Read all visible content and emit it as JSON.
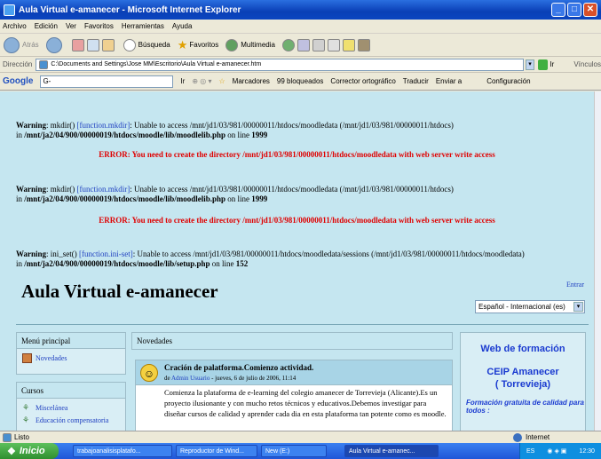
{
  "window": {
    "title": "Aula Virtual e-amanecer - Microsoft Internet Explorer",
    "controls": [
      "_",
      "□",
      "✕"
    ]
  },
  "menu": [
    "Archivo",
    "Edición",
    "Ver",
    "Favoritos",
    "Herramientas",
    "Ayuda"
  ],
  "toolbar": {
    "back": "Atrás",
    "search": "Búsqueda",
    "favorites": "Favoritos",
    "multimedia": "Multimedia"
  },
  "address": {
    "label": "Dirección",
    "value": "C:\\Documents and Settings\\Jose MM\\Escritorio\\Aula Virtual e-amanecer.htm",
    "go": "Ir",
    "links": "Vínculos"
  },
  "google": {
    "logo": "Google",
    "input": "G-",
    "go": "Ir",
    "bookmarks": "Marcadores",
    "blocked": "99 bloqueados",
    "spellcheck": "Corrector ortográfico",
    "translate": "Traducir",
    "send": "Enviar a",
    "settings": "Configuración"
  },
  "warnings": [
    {
      "label": "Warning",
      "func": "mkdir()",
      "link": "[function.mkdir]",
      "msg": ": Unable to access /mnt/jd1/03/981/00000011/htdocs/moodledata (/mnt/jd1/03/981/00000011/htdocs)",
      "in": "in",
      "path": "/mnt/ja2/04/900/00000019/htdocs/moodle/lib/moodlelib.php",
      "online": "on line",
      "line": "1999"
    },
    {
      "label": "Warning",
      "func": "mkdir()",
      "link": "[function.mkdir]",
      "msg": ": Unable to access /mnt/jd1/03/981/00000011/htdocs/moodledata (/mnt/jd1/03/981/00000011/htdocs)",
      "in": "in",
      "path": "/mnt/ja2/04/900/00000019/htdocs/moodle/lib/moodlelib.php",
      "online": "on line",
      "line": "1999"
    },
    {
      "label": "Warning",
      "func": "ini_set()",
      "link": "[function.ini-set]",
      "msg": ": Unable to access /mnt/jd1/03/981/00000011/htdocs/moodledata/sessions (/mnt/jd1/03/981/00000011/htdocs/moodledata)",
      "in": "in",
      "path": "/mnt/ja2/04/900/00000019/htdocs/moodle/lib/setup.php",
      "online": "on line",
      "line": "152"
    }
  ],
  "errors": [
    "ERROR: You need to create the directory /mnt/jd1/03/981/00000011/htdocs/moodledata with web server write access",
    "ERROR: You need to create the directory /mnt/jd1/03/981/00000011/htdocs/moodledata with web server write access"
  ],
  "site": {
    "title": "Aula Virtual e-amanecer",
    "login": "Entrar",
    "language": "Español - Internacional (es)"
  },
  "main_menu": {
    "header": "Menú principal",
    "items": [
      "Novedades"
    ]
  },
  "courses": {
    "header": "Cursos",
    "items": [
      "Miscelánea",
      "Educación compensatoria"
    ]
  },
  "news": {
    "header": "Novedades",
    "post_title": "Cración de palatforma.Comienzo actividad.",
    "post_by": "de",
    "post_author": "Admin Usuario",
    "post_date": " - jueves, 6 de julio de 2006, 11:14",
    "post_text": "Comienza la plataforma de e-learning del colegio amanecer de Torrevieja (Alicante).Es un proyecto ilusionante y con mucho retos técnicos y educativos.Debemos investigar para diseñar cursos de calidad y aprender cada dia en esta plataforma tan potente como es moodle."
  },
  "right_block": {
    "title": "Web de formación",
    "school": "CEIP Amanecer",
    "city": "( Torrevieja)",
    "tagline": "Formación gratuita de calidad para todos :"
  },
  "status": {
    "text": "Listo",
    "zone": "Internet"
  },
  "taskbar": {
    "start": "Inicio",
    "tasks": [
      "trabajoanalisisplatafo...",
      "Reproductor de Wind...",
      "New (E:)",
      "Aula Virtual e-amanec..."
    ],
    "lang": "ES",
    "clock": "12:30"
  },
  "colors": {
    "page_bg": "#c5e6f0",
    "error": "#e00000",
    "link": "#2040c0",
    "titlebar": "#0a3fb6"
  }
}
